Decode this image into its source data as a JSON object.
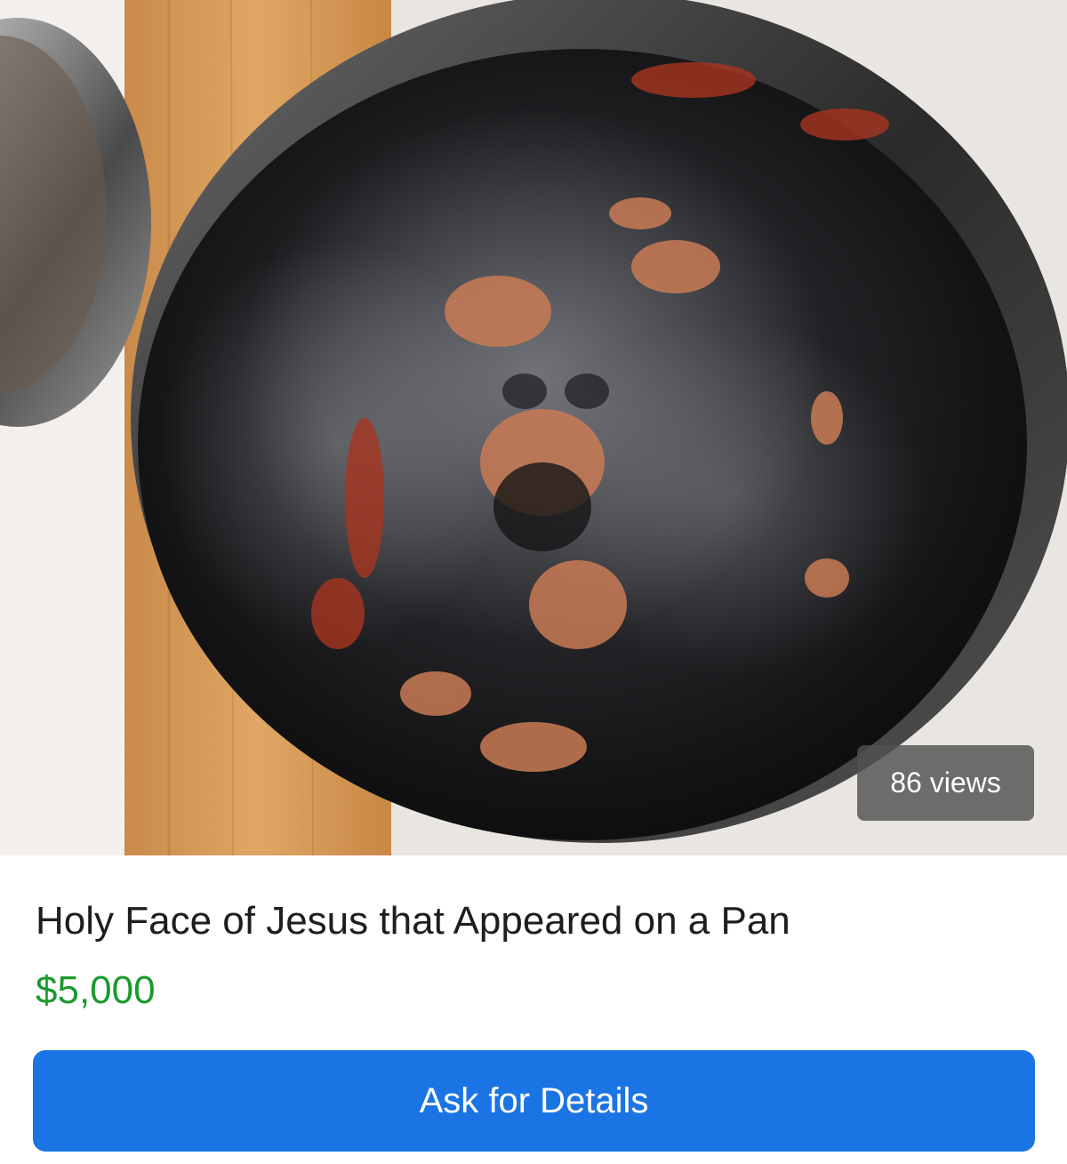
{
  "listing": {
    "photo_alt": "listing photo",
    "views": "86 views",
    "title": "Holy Face of Jesus that Appeared on a Pan",
    "price": "$5,000",
    "cta_label": "Ask for Details"
  },
  "colors": {
    "price": "#1a9a2e",
    "cta_background": "#1b74e4",
    "badge_background": "#505050"
  }
}
